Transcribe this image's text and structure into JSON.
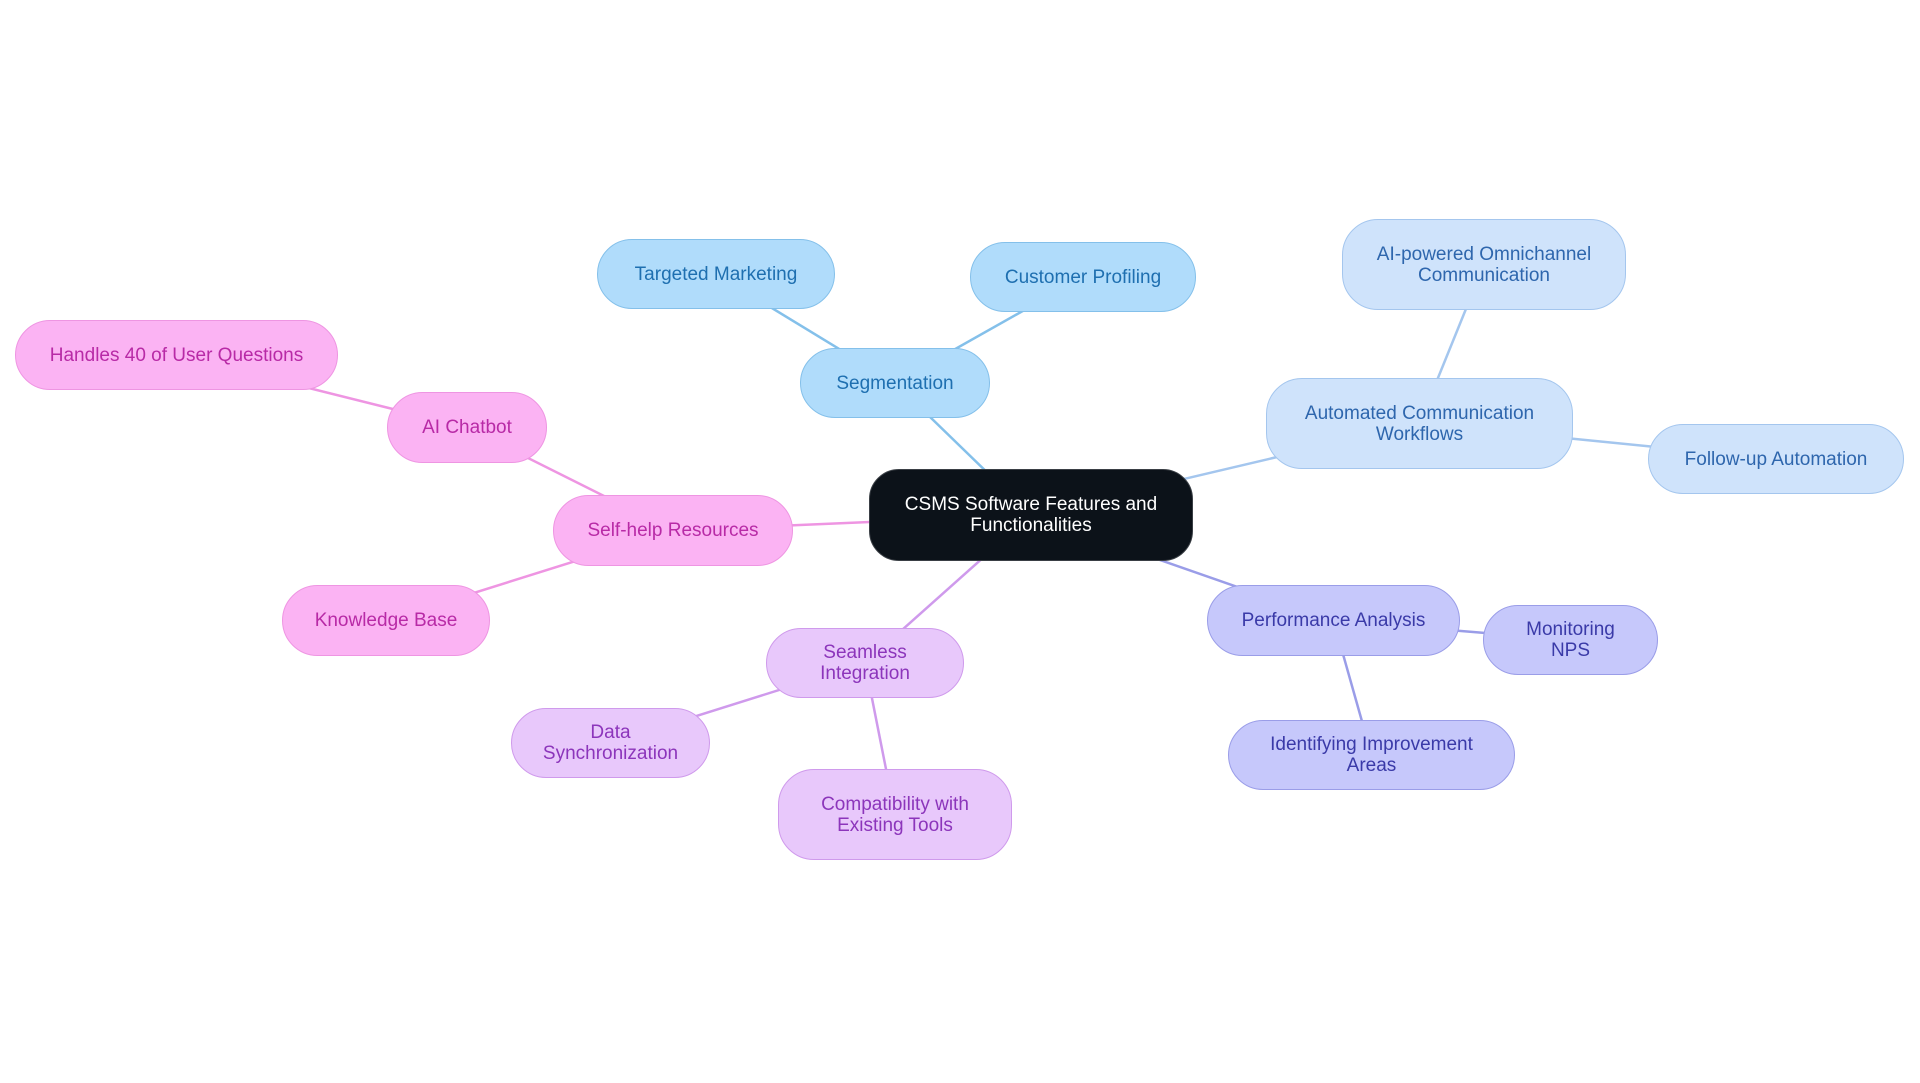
{
  "title": "CSMS Software Features and Functionalities",
  "nodes": {
    "root": "CSMS Software Features and Functionalities",
    "segmentation": "Segmentation",
    "targeted_marketing": "Targeted Marketing",
    "customer_profiling": "Customer Profiling",
    "automated_workflows": "Automated Communication Workflows",
    "ai_omnichannel": "AI-powered Omnichannel Communication",
    "follow_up": "Follow-up Automation",
    "performance_analysis": "Performance Analysis",
    "monitoring_nps": "Monitoring NPS",
    "improvement_areas": "Identifying Improvement Areas",
    "seamless_integration": "Seamless Integration",
    "data_sync": "Data Synchronization",
    "compatibility": "Compatibility with Existing Tools",
    "self_help": "Self-help Resources",
    "ai_chatbot": "AI Chatbot",
    "handles_questions": "Handles 40 of User Questions",
    "knowledge_base": "Knowledge Base"
  },
  "edges": [
    [
      "root",
      "segmentation"
    ],
    [
      "segmentation",
      "targeted_marketing"
    ],
    [
      "segmentation",
      "customer_profiling"
    ],
    [
      "root",
      "automated_workflows"
    ],
    [
      "automated_workflows",
      "ai_omnichannel"
    ],
    [
      "automated_workflows",
      "follow_up"
    ],
    [
      "root",
      "performance_analysis"
    ],
    [
      "performance_analysis",
      "monitoring_nps"
    ],
    [
      "performance_analysis",
      "improvement_areas"
    ],
    [
      "root",
      "seamless_integration"
    ],
    [
      "seamless_integration",
      "data_sync"
    ],
    [
      "seamless_integration",
      "compatibility"
    ],
    [
      "root",
      "self_help"
    ],
    [
      "self_help",
      "ai_chatbot"
    ],
    [
      "ai_chatbot",
      "handles_questions"
    ],
    [
      "self_help",
      "knowledge_base"
    ]
  ],
  "branch_colors": {
    "segmentation": "#84c0ea",
    "automated_workflows": "#a4c6ee",
    "performance_analysis": "#9a9de8",
    "seamless_integration": "#cf9aec",
    "self_help": "#ee95e2"
  }
}
